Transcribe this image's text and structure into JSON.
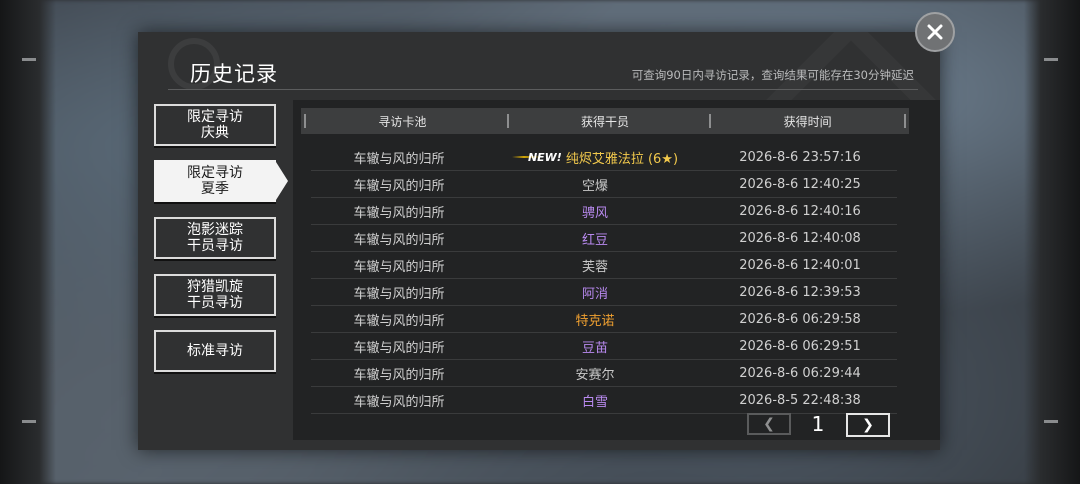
{
  "window": {
    "title": "历史记录",
    "subtitle": "可查询90日内寻访记录，查询结果可能存在30分钟延迟"
  },
  "tabs": [
    {
      "line1": "限定寻访",
      "line2": "庆典",
      "active": false
    },
    {
      "line1": "限定寻访",
      "line2": "夏季",
      "active": true
    },
    {
      "line1": "泡影迷踪",
      "line2": "干员寻访",
      "active": false
    },
    {
      "line1": "狩猎凯旋",
      "line2": "干员寻访",
      "active": false
    },
    {
      "line1": "标准寻访",
      "line2": "",
      "active": false
    }
  ],
  "table": {
    "headers": [
      "寻访卡池",
      "获得干员",
      "获得时间"
    ],
    "new_label": "NEW!",
    "rows": [
      {
        "pool": "车辙与风的归所",
        "operator": "纯烬艾雅法拉 (6★)",
        "time": "2026-8-6 23:57:16",
        "color": "#f2c94c",
        "is_new": true
      },
      {
        "pool": "车辙与风的归所",
        "operator": "空爆",
        "time": "2026-8-6 12:40:25",
        "color": "#c8c8c8",
        "is_new": false
      },
      {
        "pool": "车辙与风的归所",
        "operator": "骋风",
        "time": "2026-8-6 12:40:16",
        "color": "#b98af0",
        "is_new": false
      },
      {
        "pool": "车辙与风的归所",
        "operator": "红豆",
        "time": "2026-8-6 12:40:08",
        "color": "#b98af0",
        "is_new": false
      },
      {
        "pool": "车辙与风的归所",
        "operator": "芙蓉",
        "time": "2026-8-6 12:40:01",
        "color": "#c8c8c8",
        "is_new": false
      },
      {
        "pool": "车辙与风的归所",
        "operator": "阿消",
        "time": "2026-8-6 12:39:53",
        "color": "#b98af0",
        "is_new": false
      },
      {
        "pool": "车辙与风的归所",
        "operator": "特克诺",
        "time": "2026-8-6 06:29:58",
        "color": "#f0a030",
        "is_new": false
      },
      {
        "pool": "车辙与风的归所",
        "operator": "豆苗",
        "time": "2026-8-6 06:29:51",
        "color": "#b98af0",
        "is_new": false
      },
      {
        "pool": "车辙与风的归所",
        "operator": "安赛尔",
        "time": "2026-8-6 06:29:44",
        "color": "#c8c8c8",
        "is_new": false
      },
      {
        "pool": "车辙与风的归所",
        "operator": "白雪",
        "time": "2026-8-5 22:48:38",
        "color": "#b98af0",
        "is_new": false
      }
    ]
  },
  "pager": {
    "page": "1",
    "prev_icon": "chevron-left-icon",
    "next_icon": "chevron-right-icon"
  },
  "close_icon": "close-icon"
}
